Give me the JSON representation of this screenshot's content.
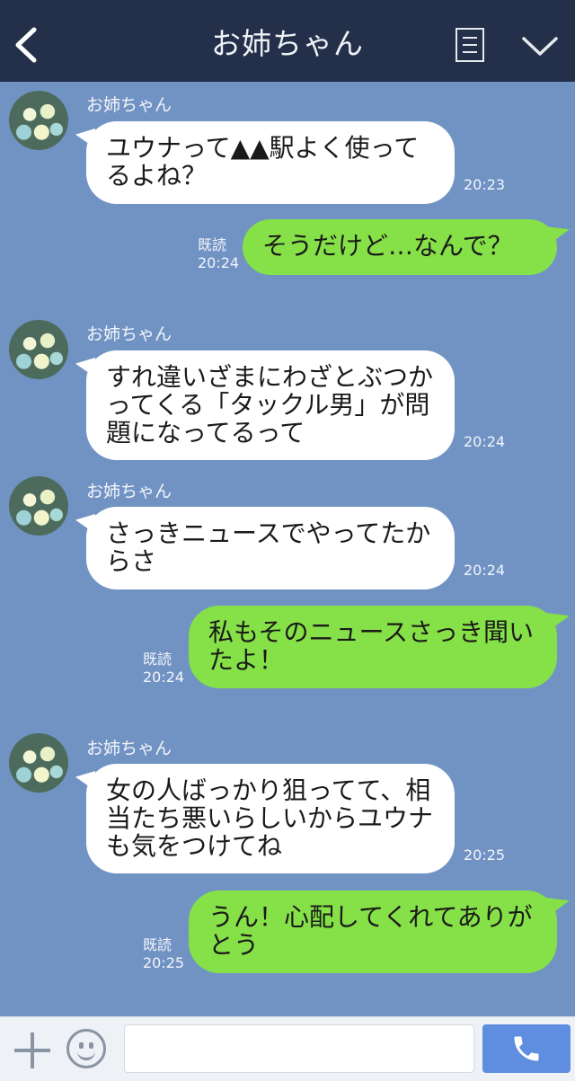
{
  "header": {
    "title": "お姉ちゃん"
  },
  "messages": [
    {
      "dir": "in",
      "sender": "お姉ちゃん",
      "text": "ユウナって▲▲駅よく使ってるよね？",
      "time": "20:23"
    },
    {
      "dir": "out",
      "text": "そうだけど…なんで？",
      "read": "既読",
      "time": "20:24"
    },
    {
      "dir": "in",
      "sender": "お姉ちゃん",
      "text": "すれ違いざまにわざとぶつかってくる「タックル男」が問題になってるって",
      "time": "20:24"
    },
    {
      "dir": "in",
      "sender": "お姉ちゃん",
      "text": "さっきニュースでやってたからさ",
      "time": "20:24"
    },
    {
      "dir": "out",
      "text": "私もそのニュースさっき聞いたよ！",
      "read": "既読",
      "time": "20:24"
    },
    {
      "dir": "in",
      "sender": "お姉ちゃん",
      "text": "女の人ばっかり狙ってて、相当たち悪いらしいからユウナも気をつけてね",
      "time": "20:25"
    },
    {
      "dir": "out",
      "text": "うん！心配してくれてありがとう",
      "read": "既読",
      "time": "20:25"
    }
  ],
  "composer": {
    "placeholder": ""
  },
  "colors": {
    "header": "#243049",
    "background": "#7193c4",
    "outgoing": "#86e047",
    "incoming": "#ffffff",
    "send": "#5f8de0"
  }
}
